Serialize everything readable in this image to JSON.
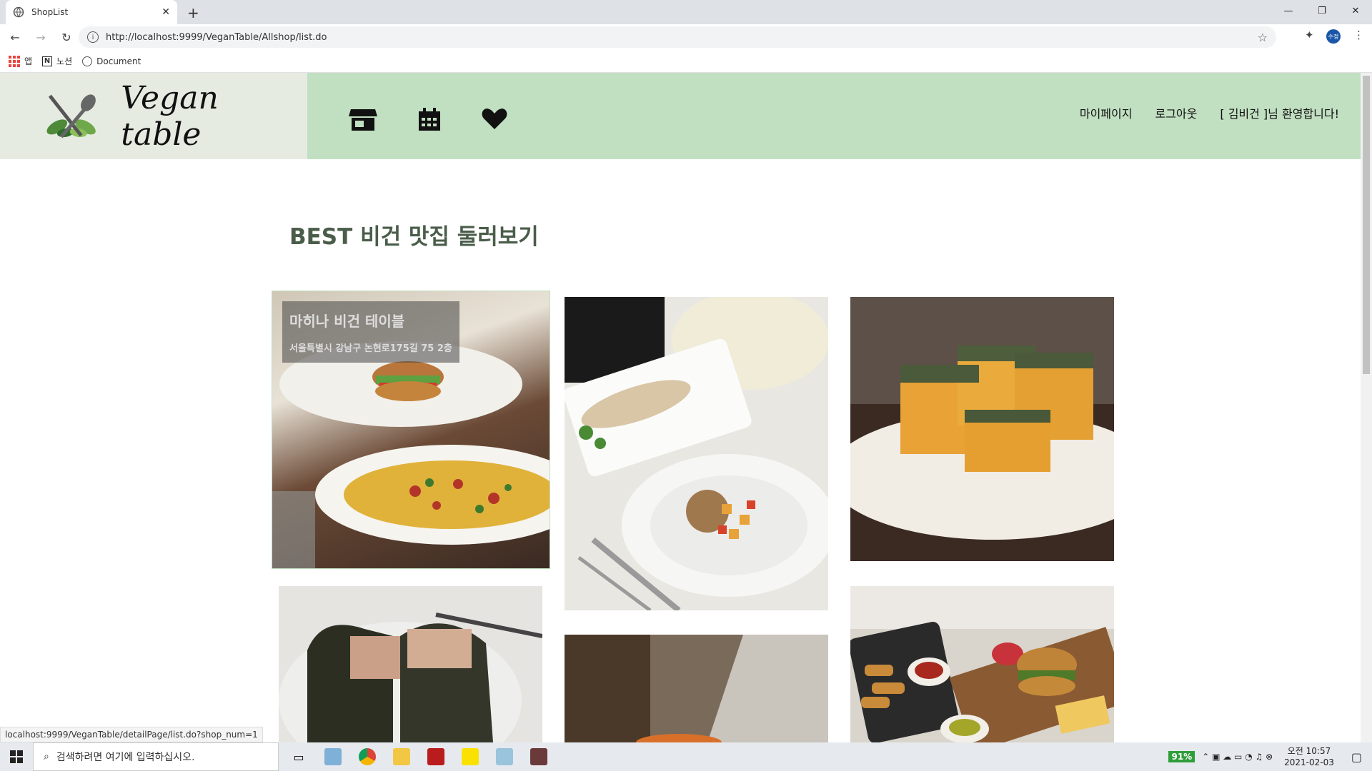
{
  "browser": {
    "tab_title": "ShopList",
    "url": "http://localhost:9999/VeganTable/Allshop/list.do",
    "bookmarks": [
      "앱",
      "노션",
      "Document"
    ],
    "profile": "수정"
  },
  "header": {
    "logo_text": "Vegan table",
    "nav": [
      "마이페이지",
      "로그아웃",
      "[ 김비건 ]님 환영합니다!"
    ]
  },
  "section": {
    "title": "BEST 비건 맛집 둘러보기"
  },
  "cards": [
    {
      "name": "마히나 비건 테이블",
      "address": "서울특별시 강남구 논현로175길 75 2층"
    }
  ],
  "status_url": "localhost:9999/VeganTable/detailPage/list.do?shop_num=1",
  "taskbar": {
    "search_placeholder": "검색하려면 여기에 입력하십시오.",
    "battery": "91%",
    "time": "오전 10:57",
    "date": "2021-02-03"
  },
  "colors": {
    "header_green": "#c1dfc1",
    "logo_panel": "#e6ebe2",
    "title_text": "#4a5d4a"
  }
}
